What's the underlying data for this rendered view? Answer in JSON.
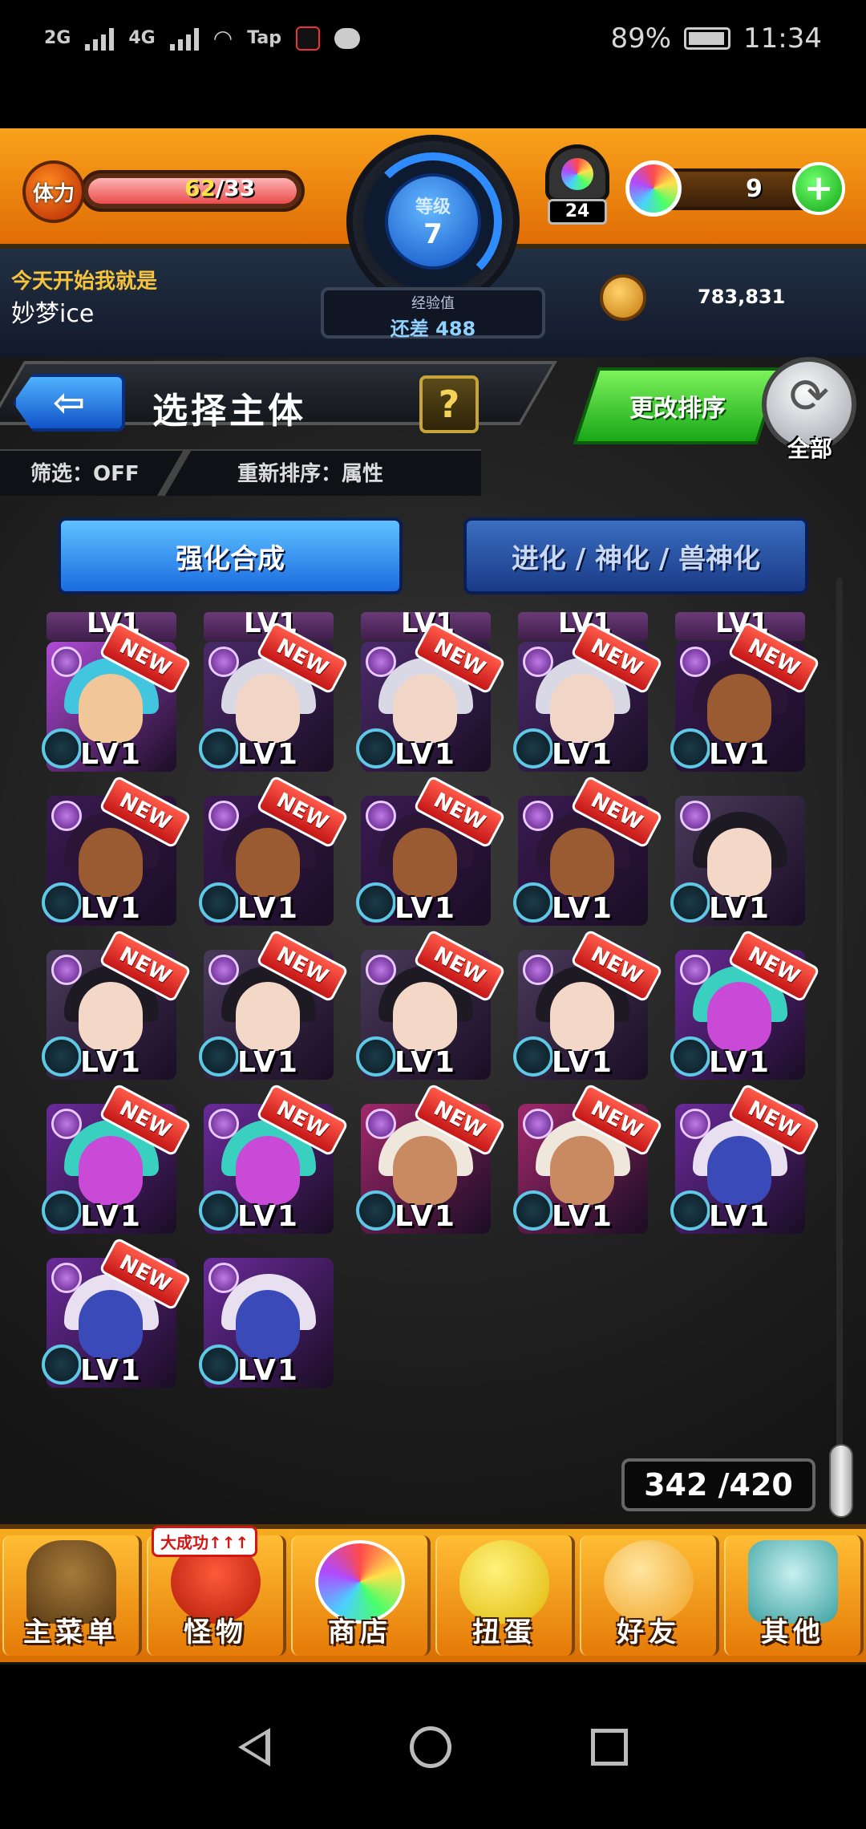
{
  "status_bar": {
    "signal1_label": "2G",
    "signal2_label": "4G",
    "tap_label": "Tap",
    "battery_text": "89%",
    "time": "11:34",
    "icons": [
      "signal-icon",
      "signal-icon",
      "wifi-icon",
      "tap-icon",
      "tiktok-icon",
      "message-icon",
      "battery-icon"
    ]
  },
  "hud": {
    "stamina_label": "体力",
    "stamina_current": "62",
    "stamina_max": "/33",
    "rank_label": "等级",
    "rank_value": "7",
    "exp_label": "经验值",
    "exp_text": "还差 488",
    "gem_count": "24",
    "orb_count": "9",
    "plus_label": "+",
    "tagline": "今天开始我就是",
    "user_name": "妙梦ice",
    "coin_value": "783,831"
  },
  "header": {
    "back_label": "⇦",
    "title": "选择主体",
    "help_label": "?",
    "filter_label": "筛选：OFF",
    "sort_label": "重新排序：属性",
    "change_sort_label": "更改排序",
    "refresh_glyph": "⟳",
    "refresh_label": "全部"
  },
  "tabs": {
    "strengthen": "强化合成",
    "evolve": "进化 / 神化 / 兽神化"
  },
  "monsters": {
    "level_label": "LV1",
    "new_label": "NEW",
    "partial_count": 5,
    "items": [
      {
        "type": "snake-hair girl",
        "is_new": true
      },
      {
        "type": "silver-haired swordsman",
        "is_new": true
      },
      {
        "type": "silver-haired swordsman",
        "is_new": true
      },
      {
        "type": "silver-haired swordsman",
        "is_new": true
      },
      {
        "type": "dark-skinned warrior",
        "is_new": true
      },
      {
        "type": "dark-skinned warrior",
        "is_new": true
      },
      {
        "type": "dark-skinned warrior",
        "is_new": true
      },
      {
        "type": "dark-skinned warrior",
        "is_new": true
      },
      {
        "type": "dark-skinned warrior",
        "is_new": true
      },
      {
        "type": "dark-haired agent",
        "is_new": false
      },
      {
        "type": "dark-haired agent",
        "is_new": true
      },
      {
        "type": "dark-haired agent",
        "is_new": true
      },
      {
        "type": "dark-haired agent",
        "is_new": true
      },
      {
        "type": "dark-haired agent",
        "is_new": true
      },
      {
        "type": "purple dragon",
        "is_new": true
      },
      {
        "type": "purple dragon",
        "is_new": true
      },
      {
        "type": "purple dragon",
        "is_new": true
      },
      {
        "type": "white-haired witch",
        "is_new": true
      },
      {
        "type": "white-haired witch",
        "is_new": true
      },
      {
        "type": "blue demon",
        "is_new": true
      },
      {
        "type": "blue demon",
        "is_new": true
      },
      {
        "type": "blue demon",
        "is_new": false
      }
    ]
  },
  "box_count": "342 /420",
  "bottom_nav": {
    "items": [
      {
        "label": "主菜单",
        "icon": "gate-icon"
      },
      {
        "label": "怪物",
        "icon": "monster-icon",
        "badge": "大成功↑↑↑"
      },
      {
        "label": "商店",
        "icon": "orb-icon"
      },
      {
        "label": "扭蛋",
        "icon": "egg-icon"
      },
      {
        "label": "好友",
        "icon": "friends-icon"
      },
      {
        "label": "其他",
        "icon": "question-icon"
      }
    ]
  },
  "colors": {
    "hud_orange": "#f9a21b",
    "tab_blue": "#1a6be0",
    "new_red": "#d31515",
    "monster_purple": "#5a1f80"
  }
}
